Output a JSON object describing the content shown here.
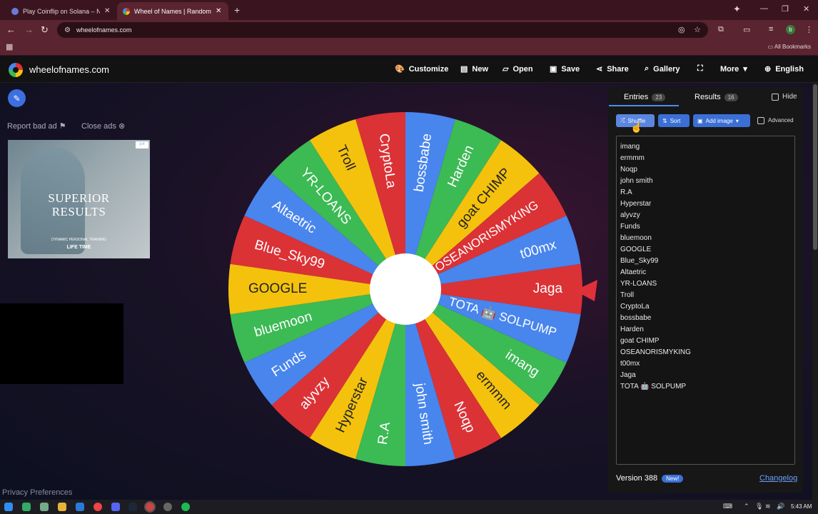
{
  "browser": {
    "tabs": [
      {
        "title": "Play Coinflip on Solana – No K"
      },
      {
        "title": "Wheel of Names | Random nam"
      }
    ],
    "url": "wheelofnames.com",
    "all_bookmarks": "All Bookmarks",
    "profile_initial": "b"
  },
  "header": {
    "site_name": "wheelofnames.com",
    "nav": {
      "customize": "Customize",
      "new": "New",
      "open": "Open",
      "save": "Save",
      "share": "Share",
      "gallery": "Gallery",
      "more": "More",
      "language": "English"
    }
  },
  "ads": {
    "report": "Report bad ad",
    "close": "Close ads",
    "headline": "SUPERIOR\nRESULTS",
    "subline": "DYNAMIC PERSONAL TRAINING",
    "brand": "LIFE TIME"
  },
  "wheel": {
    "colors": [
      "#db3236",
      "#4885ed",
      "#3cba54",
      "#f4c20d"
    ],
    "segments": [
      "Jaga",
      "TOTA 🤖 SOLPUMP",
      "imang",
      "ermmm",
      "Noqp",
      "john smith",
      "R.A",
      "Hyperstar",
      "alyvzy",
      "Funds",
      "bluemoon",
      "GOOGLE",
      "Blue_Sky99",
      "Altaetric",
      "YR-LOANS",
      "Troll",
      "CryptoLa",
      "bossbabe",
      "Harden",
      "goat CHIMP",
      "OSEANORISMYKING",
      "t00mx"
    ]
  },
  "panel": {
    "entries_tab": "Entries",
    "entries_count": "23",
    "results_tab": "Results",
    "results_count": "16",
    "hide": "Hide",
    "shuffle": "Shuffle",
    "sort": "Sort",
    "add_image": "Add image",
    "advanced": "Advanced",
    "entries": [
      "imang",
      "ermmm",
      "Noqp",
      "john smith",
      "R.A",
      "Hyperstar",
      "alyvzy",
      "Funds",
      "bluemoon",
      "GOOGLE",
      "Blue_Sky99",
      "Altaetric",
      "YR-LOANS",
      "Troll",
      "CryptoLa",
      "bossbabe",
      "Harden",
      "goat CHIMP",
      "OSEANORISMYKING",
      "t00mx",
      "Jaga",
      "TOTA 🤖 SOLPUMP"
    ],
    "version": "Version 388",
    "new_badge": "New!",
    "changelog": "Changelog"
  },
  "footer": {
    "privacy": "Privacy Preferences"
  },
  "taskbar": {
    "clock": "5:43 AM"
  }
}
